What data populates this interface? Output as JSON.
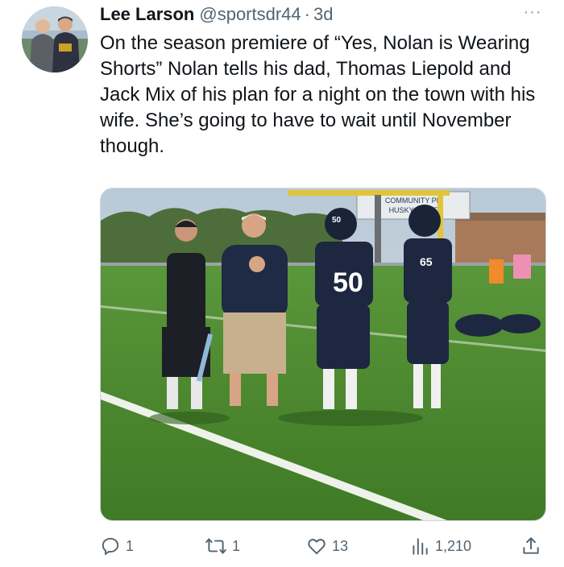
{
  "tweet": {
    "author_name": "Lee Larson",
    "handle": "@sportsdr44",
    "separator": "·",
    "time": "3d",
    "more_label": "···",
    "text": "On the season premiere of “Yes, Nolan is Wearing Shorts” Nolan tells his dad, Thomas Liepold and Jack Mix of his plan for a night on the town with his wife. She’s going to have to wait until November though."
  },
  "media": {
    "sign_line1": "COMMUNITY PR",
    "sign_line2": "HUSKY PRIDE",
    "jersey_left": "50",
    "jersey_right": "65",
    "helmet_number": "50"
  },
  "actions": {
    "replies": "1",
    "reposts": "1",
    "likes": "13",
    "views": "1,210"
  },
  "colors": {
    "text": "#0f1419",
    "secondary": "#536471",
    "grass": "#4f8a2d",
    "navy": "#1d2740"
  }
}
